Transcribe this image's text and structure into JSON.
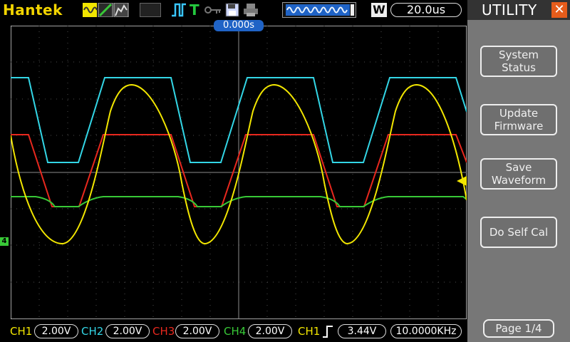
{
  "topbar": {
    "brand": "Hantek",
    "trigger_mode_label": "T",
    "timebase": "20.0us",
    "wave_badge": "W"
  },
  "icons": {
    "channels": "channel-waveform-icons",
    "run": "pulse-run-icon",
    "key": "key-icon",
    "save": "floppy-disk-icon",
    "print": "printer-icon",
    "memory": "memory-waveform-icon"
  },
  "scope": {
    "trigger_time": "0.000s"
  },
  "sidebar": {
    "title": "UTILITY",
    "items": [
      {
        "label": "System\nStatus"
      },
      {
        "label": "Update\nFirmware"
      },
      {
        "label": "Save\nWaveform"
      },
      {
        "label": "Do Self Cal"
      }
    ],
    "page": "Page 1/4"
  },
  "status": {
    "ch1_label": "CH1",
    "ch1_val": "2.00V",
    "ch2_label": "CH2",
    "ch2_val": "2.00V",
    "ch3_label": "CH3",
    "ch3_val": "2.00V",
    "ch4_label": "CH4",
    "ch4_val": "2.00V",
    "trig_ch_label": "CH1",
    "trig_level": "3.44V",
    "trig_freq": "10.0000KHz"
  },
  "ch4_marker": "4",
  "colors": {
    "ch1": "#f2e600",
    "ch2": "#33d6e6",
    "ch3": "#e8281e",
    "ch4": "#38c937",
    "brand": "#f2d400",
    "accent": "#1f63c6"
  }
}
